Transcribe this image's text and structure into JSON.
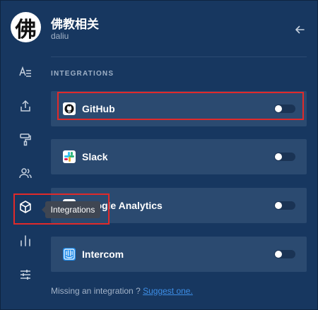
{
  "header": {
    "avatar_glyph": "佛",
    "title": "佛教相关",
    "subtitle": "daliu",
    "back_icon": "arrow-left-icon"
  },
  "sidebar": {
    "items": [
      {
        "icon": "text-format-icon",
        "label": "General"
      },
      {
        "icon": "upload-icon",
        "label": "Share"
      },
      {
        "icon": "paint-roller-icon",
        "label": "Theme"
      },
      {
        "icon": "users-icon",
        "label": "Members"
      },
      {
        "icon": "cube-icon",
        "label": "Integrations"
      },
      {
        "icon": "bar-chart-icon",
        "label": "Analytics"
      },
      {
        "icon": "sliders-icon",
        "label": "Settings"
      }
    ],
    "tooltip": "Integrations"
  },
  "integrations": {
    "heading": "INTEGRATIONS",
    "items": [
      {
        "name": "GitHub",
        "icon": "github-icon",
        "enabled": false
      },
      {
        "name": "Slack",
        "icon": "slack-icon",
        "enabled": false
      },
      {
        "name": "Google Analytics",
        "icon": "google-analytics-icon",
        "enabled": false
      },
      {
        "name": "Intercom",
        "icon": "intercom-icon",
        "enabled": false
      }
    ]
  },
  "footer": {
    "text": "Missing an integration ?",
    "link": "Suggest one."
  },
  "colors": {
    "background": "#173760",
    "card": "#2b4a70",
    "accent_link": "#3d8ee6",
    "highlight": "#e02a2a"
  }
}
